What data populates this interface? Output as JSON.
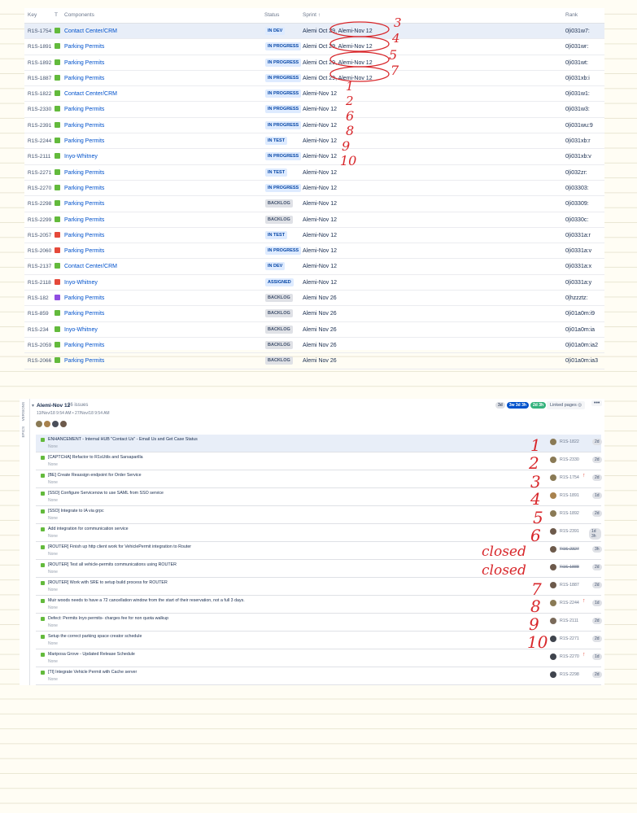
{
  "top_table": {
    "headers": {
      "key": "Key",
      "type": "T",
      "components": "Components",
      "status": "Status",
      "sprint": "Sprint",
      "rank": "Rank"
    },
    "sprint_sort_icon": "arrow-up-icon",
    "rows": [
      {
        "key": "R1S-1754",
        "type": "story",
        "component": "Contact Center/CRM",
        "status": "IN DEV",
        "status_color": "blue",
        "sprint": "Alemi Oct 29, Alemi-Nov 12",
        "rank": "0|i031w7:",
        "selected": true
      },
      {
        "key": "R1S-1891",
        "type": "story",
        "component": "Parking Permits",
        "status": "IN PROGRESS",
        "status_color": "blue",
        "sprint": "Alemi Oct 29, Alemi-Nov 12",
        "rank": "0|i031wr:"
      },
      {
        "key": "R1S-1892",
        "type": "story",
        "component": "Parking Permits",
        "status": "IN PROGRESS",
        "status_color": "blue",
        "sprint": "Alemi Oct 29, Alemi-Nov 12",
        "rank": "0|i031wt:"
      },
      {
        "key": "R1S-1887",
        "type": "story",
        "component": "Parking Permits",
        "status": "IN PROGRESS",
        "status_color": "blue",
        "sprint": "Alemi Oct 29, Alemi-Nov 12",
        "rank": "0|i031xb:i"
      },
      {
        "key": "R1S-1822",
        "type": "story",
        "component": "Contact Center/CRM",
        "status": "IN PROGRESS",
        "status_color": "blue",
        "sprint": "Alemi-Nov 12",
        "rank": "0|i031w1:"
      },
      {
        "key": "R1S-2330",
        "type": "story",
        "component": "Parking Permits",
        "status": "IN PROGRESS",
        "status_color": "blue",
        "sprint": "Alemi-Nov 12",
        "rank": "0|i031w3:"
      },
      {
        "key": "R1S-2391",
        "type": "story",
        "component": "Parking Permits",
        "status": "IN PROGRESS",
        "status_color": "blue",
        "sprint": "Alemi-Nov 12",
        "rank": "0|i031wu:9"
      },
      {
        "key": "R1S-2244",
        "type": "story",
        "component": "Parking Permits",
        "status": "IN TEST",
        "status_color": "blue",
        "sprint": "Alemi-Nov 12",
        "rank": "0|i031xb:r"
      },
      {
        "key": "R1S-2111",
        "type": "story",
        "component": "Inyo-Whitney",
        "status": "IN PROGRESS",
        "status_color": "blue",
        "sprint": "Alemi-Nov 12",
        "rank": "0|i031xb:v"
      },
      {
        "key": "R1S-2271",
        "type": "story",
        "component": "Parking Permits",
        "status": "IN TEST",
        "status_color": "blue",
        "sprint": "Alemi-Nov 12",
        "rank": "0|i032zr:"
      },
      {
        "key": "R1S-2270",
        "type": "story",
        "component": "Parking Permits",
        "status": "IN PROGRESS",
        "status_color": "blue",
        "sprint": "Alemi-Nov 12",
        "rank": "0|i03303:"
      },
      {
        "key": "R1S-2298",
        "type": "story",
        "component": "Parking Permits",
        "status": "BACKLOG",
        "status_color": "gray",
        "sprint": "Alemi-Nov 12",
        "rank": "0|i03309:"
      },
      {
        "key": "R1S-2299",
        "type": "story",
        "component": "Parking Permits",
        "status": "BACKLOG",
        "status_color": "gray",
        "sprint": "Alemi-Nov 12",
        "rank": "0|i0330c:"
      },
      {
        "key": "R1S-2057",
        "type": "bug",
        "component": "Parking Permits",
        "status": "IN TEST",
        "status_color": "blue",
        "sprint": "Alemi-Nov 12",
        "rank": "0|i0331a:r"
      },
      {
        "key": "R1S-2060",
        "type": "bug",
        "component": "Parking Permits",
        "status": "IN PROGRESS",
        "status_color": "blue",
        "sprint": "Alemi-Nov 12",
        "rank": "0|i0331a:v"
      },
      {
        "key": "R1S-2137",
        "type": "story",
        "component": "Contact Center/CRM",
        "status": "IN DEV",
        "status_color": "blue",
        "sprint": "Alemi-Nov 12",
        "rank": "0|i0331a:x"
      },
      {
        "key": "R1S-2118",
        "type": "bug",
        "component": "Inyo-Whitney",
        "status": "ASSIGNED",
        "status_color": "blue",
        "sprint": "Alemi-Nov 12",
        "rank": "0|i0331a:y"
      },
      {
        "key": "R1S-182",
        "type": "epic",
        "component": "Parking Permits",
        "status": "BACKLOG",
        "status_color": "gray",
        "sprint": "Alemi Nov 26",
        "rank": "0|hzzztz:"
      },
      {
        "key": "R1S-859",
        "type": "story",
        "component": "Parking Permits",
        "status": "BACKLOG",
        "status_color": "gray",
        "sprint": "Alemi Nov 26",
        "rank": "0|i01a0m:i9"
      },
      {
        "key": "R1S-234",
        "type": "story",
        "component": "Inyo-Whitney",
        "status": "BACKLOG",
        "status_color": "gray",
        "sprint": "Alemi Nov 26",
        "rank": "0|i01a0m:ia"
      },
      {
        "key": "R1S-2059",
        "type": "story",
        "component": "Parking Permits",
        "status": "BACKLOG",
        "status_color": "gray",
        "sprint": "Alemi Nov 26",
        "rank": "0|i01a0m:ia2"
      },
      {
        "key": "R1S-2066",
        "type": "story",
        "component": "Parking Permits",
        "status": "BACKLOG",
        "status_color": "gray",
        "sprint": "Alemi Nov 26",
        "rank": "0|i01a0m:ia3"
      }
    ]
  },
  "top_annotations": [
    "3",
    "4",
    "5",
    "7",
    "1",
    "2",
    "6",
    "8",
    "9",
    "10"
  ],
  "sprint_panel": {
    "side_tabs": [
      "VERSIONS",
      "EPICS"
    ],
    "name": "Alemi-Nov 12",
    "issue_count": "26 issues",
    "dates": "13/Nov/18 9:54 AM • 27/Nov/18 9:54 AM",
    "badges": [
      {
        "label": "3d",
        "color": "#dfe1e6",
        "text": "#42526e"
      },
      {
        "label": "3w 3d 3h",
        "color": "#0052cc",
        "text": "#ffffff"
      },
      {
        "label": "2d 3h",
        "color": "#36b37e",
        "text": "#ffffff"
      }
    ],
    "linked_pages": "Linked pages",
    "more_icon": "more-icon",
    "issues": [
      {
        "summary": "ENHANCEMENT - Internal HUB \"Contact Us\" - Email Us and Get Case Status",
        "epic": "None",
        "key": "R1S-1822",
        "est": "2d",
        "priority": "",
        "struck": false,
        "selected": true
      },
      {
        "summary": "[CAPTCHA] Refactor to R1sUtils and Sarsaparilla",
        "epic": "None",
        "key": "R1S-2330",
        "est": "2d",
        "priority": "",
        "struck": false
      },
      {
        "summary": "[BE] Create Reassign endpoint for Order Service",
        "epic": "None",
        "key": "R1S-1754",
        "est": "2d",
        "priority": "high",
        "struck": false
      },
      {
        "summary": "[SSO] Configure Servicenow to use SAML from SSO service",
        "epic": "None",
        "key": "R1S-1891",
        "est": "1d",
        "priority": "",
        "struck": false
      },
      {
        "summary": "[SSO] Integrate to IA via grpc",
        "epic": "None",
        "key": "R1S-1892",
        "est": "2d",
        "priority": "",
        "struck": false
      },
      {
        "summary": "Add integration for communication service",
        "epic": "None",
        "key": "R1S-2391",
        "est": "1d 3h",
        "priority": "",
        "struck": false
      },
      {
        "summary": "[ROUTER] Finish up http client work for VehiclePermit integration to Router",
        "epic": "None",
        "key": "R1S-2327",
        "est": "3h",
        "priority": "",
        "struck": true
      },
      {
        "summary": "[ROUTER] Test all vehicle-permits communications using ROUTER",
        "epic": "None",
        "key": "R1S-1888",
        "est": "2d",
        "priority": "",
        "struck": true
      },
      {
        "summary": "[ROUTER] Work with SRE to setup build process for ROUTER",
        "epic": "None",
        "key": "R1S-1887",
        "est": "2d",
        "priority": "",
        "struck": false
      },
      {
        "summary": "Muir woods needs to have a 72 cancellation window from the start of their reservation, not a full 3 days.",
        "epic": "None",
        "key": "R1S-2244",
        "est": "1d",
        "priority": "high",
        "struck": false
      },
      {
        "summary": "Defect: Permits Inyo permits- charges fee for non quota walkup",
        "epic": "None",
        "key": "R1S-2111",
        "est": "2d",
        "priority": "",
        "struck": false
      },
      {
        "summary": "Setup the correct parking space creator schedule",
        "epic": "None",
        "key": "R1S-2271",
        "est": "2d",
        "priority": "",
        "struck": false
      },
      {
        "summary": "Mariposa Grove - Updated Release Schedule",
        "epic": "None",
        "key": "R1S-2270",
        "est": "1d",
        "priority": "highest",
        "struck": false
      },
      {
        "summary": "[TI] Integrate Vehicle Permit with Cache server",
        "epic": "None",
        "key": "R1S-2298",
        "est": "2d",
        "priority": "",
        "struck": false
      }
    ]
  },
  "bottom_annotations": [
    "1",
    "2",
    "3",
    "4",
    "5",
    "6",
    "closed",
    "closed",
    "7",
    "8",
    "9",
    "10"
  ],
  "colors": {
    "link": "#0052cc",
    "story": "#63ba3c",
    "bug": "#e5493a",
    "epic": "#904ee2",
    "ink": "#d8272b"
  }
}
